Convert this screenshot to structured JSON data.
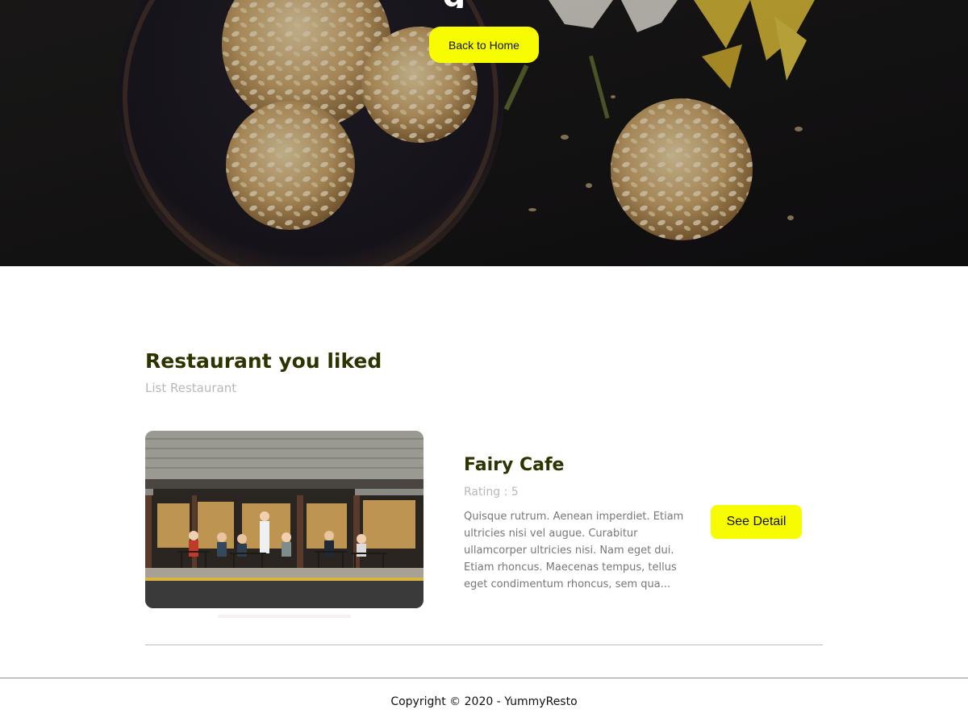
{
  "hero": {
    "title_fragment": "g",
    "back_button_label": "Back to Home"
  },
  "section": {
    "title": "Restaurant you liked",
    "subtitle": "List Restaurant"
  },
  "restaurants": [
    {
      "name": "Fairy Cafe",
      "rating_text": "Rating : 5",
      "description": "Quisque rutrum. Aenean imperdiet. Etiam ultricies nisi vel augue. Curabitur ullamcorper ultricies nisi. Nam eget dui. Etiam rhoncus. Maecenas tempus, tellus eget condimentum rhoncus, sem qua...",
      "detail_button_label": "See Detail"
    }
  ],
  "footer": {
    "copyright": "Copyright © 2020 - YummyResto"
  },
  "colors": {
    "accent": "#f8fc00",
    "heading": "#2e3300",
    "muted": "#b8b8b8"
  }
}
